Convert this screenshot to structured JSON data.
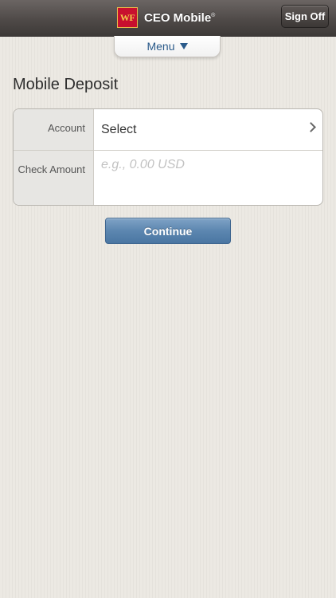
{
  "header": {
    "logo_text": "WF",
    "app_title": "CEO Mobile",
    "trademark": "®",
    "sign_off_label": "Sign Off"
  },
  "menu": {
    "label": "Menu",
    "icon": "triangle-down-icon"
  },
  "page": {
    "title": "Mobile Deposit"
  },
  "form": {
    "account_label": "Account",
    "account_value": "Select",
    "check_amount_label": "Check Amount",
    "check_amount_placeholder": "e.g., 0.00 USD",
    "check_amount_value": ""
  },
  "actions": {
    "continue_label": "Continue"
  },
  "colors": {
    "header_bg": "#4f4a48",
    "brand_red": "#c8102e",
    "brand_gold": "#f3c84b",
    "menu_text": "#2a5a8a",
    "button_blue": "#5c86b0"
  }
}
